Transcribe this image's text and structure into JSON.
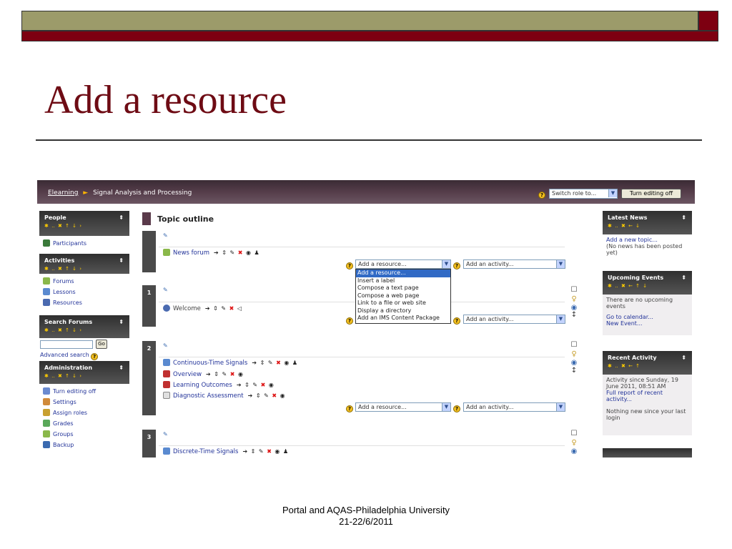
{
  "slide": {
    "title": "Add a resource",
    "footer_line1": "Portal and AQAS-Philadelphia University",
    "footer_line2": "21-22/6/2011"
  },
  "colors": {
    "olive": "#9c9b6a",
    "maroon": "#7d0011",
    "title": "#6e0b14",
    "link": "#223399"
  },
  "topbar": {
    "crumb_link": "Elearning",
    "crumb_sep": "►",
    "crumb_current": "Signal Analysis and Processing",
    "role_select": "Switch role to...",
    "editing_button": "Turn editing off"
  },
  "left": {
    "people": {
      "title": "People",
      "items": [
        "Participants"
      ]
    },
    "activities": {
      "title": "Activities",
      "items": [
        "Forums",
        "Lessons",
        "Resources"
      ]
    },
    "search": {
      "title": "Search Forums",
      "go": "Go",
      "advanced": "Advanced search"
    },
    "admin": {
      "title": "Administration",
      "items": [
        "Turn editing off",
        "Settings",
        "Assign roles",
        "Grades",
        "Groups",
        "Backup"
      ]
    }
  },
  "center": {
    "heading": "Topic outline",
    "section0": {
      "items": [
        "News forum"
      ]
    },
    "section1": {
      "number": "1",
      "items": [
        "Welcome"
      ]
    },
    "section2": {
      "number": "2",
      "items": [
        "Continuous-Time Signals",
        "Overview",
        "Learning Outcomes",
        "Diagnostic Assessment"
      ]
    },
    "section3": {
      "number": "3",
      "items": [
        "Discrete-Time Signals"
      ]
    },
    "add_resource": "Add a resource...",
    "add_activity": "Add an activity...",
    "dropdown_options": [
      "Add a resource...",
      "Insert a label",
      "Compose a text page",
      "Compose a web page",
      "Link to a file or web site",
      "Display a directory",
      "Add an IMS Content Package"
    ]
  },
  "right": {
    "news": {
      "title": "Latest News",
      "add_topic": "Add a new topic...",
      "empty": "(No news has been posted yet)"
    },
    "events": {
      "title": "Upcoming Events",
      "empty": "There are no upcoming events",
      "calendar": "Go to calendar...",
      "new_event": "New Event..."
    },
    "recent": {
      "title": "Recent Activity",
      "since": "Activity since Sunday, 19 June 2011, 08:51 AM",
      "full_report": "Full report of recent activity...",
      "nothing": "Nothing new since your last login"
    }
  }
}
